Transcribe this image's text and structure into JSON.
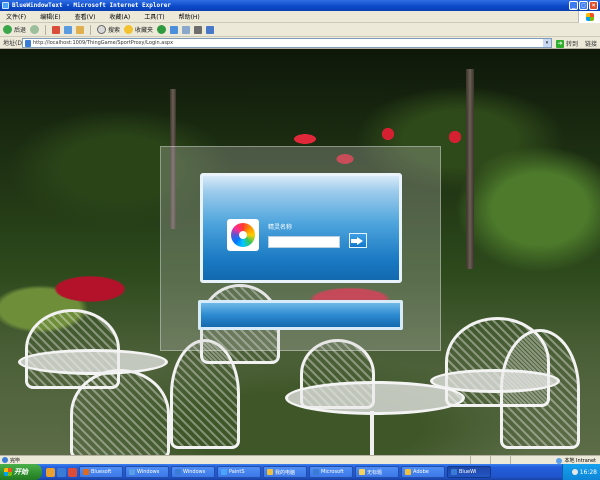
{
  "window": {
    "title": "BlueWindowText - Microsoft Internet Explorer",
    "controls": [
      "_",
      "□",
      "×"
    ]
  },
  "menu": {
    "items": [
      "文件(F)",
      "编辑(E)",
      "查看(V)",
      "收藏(A)",
      "工具(T)",
      "帮助(H)"
    ]
  },
  "toolbar": {
    "back_label": "后退",
    "search_label": "搜索",
    "favorites_label": "收藏夹"
  },
  "address": {
    "label": "地址(D)",
    "url": "http://localhost:1009/ThingGame/SportProxy/Login.aspx",
    "go_label": "转到",
    "links_label": "链接"
  },
  "login": {
    "label": "精灵名称",
    "username_value": ""
  },
  "statusbar": {
    "text": "完毕",
    "zone": "本地 Intranet"
  },
  "taskbar": {
    "start_label": "开始",
    "tasks": [
      {
        "label": "Bluesoft",
        "color": "#e06a1a"
      },
      {
        "label": "Windows",
        "color": "#5aa0e8"
      },
      {
        "label": "Windows",
        "color": "#3a7bd5"
      },
      {
        "label": "PaintS",
        "color": "#4aa3ff"
      },
      {
        "label": "我的电脑",
        "color": "#f0c040"
      },
      {
        "label": "Microsoft",
        "color": "#3a7bd5"
      },
      {
        "label": "无标题",
        "color": "#f5d35a"
      },
      {
        "label": "Adobe",
        "color": "#f0c040"
      },
      {
        "label": "BlueWi",
        "color": "#3a7bd5",
        "active": true
      }
    ],
    "clock": "16:28"
  }
}
